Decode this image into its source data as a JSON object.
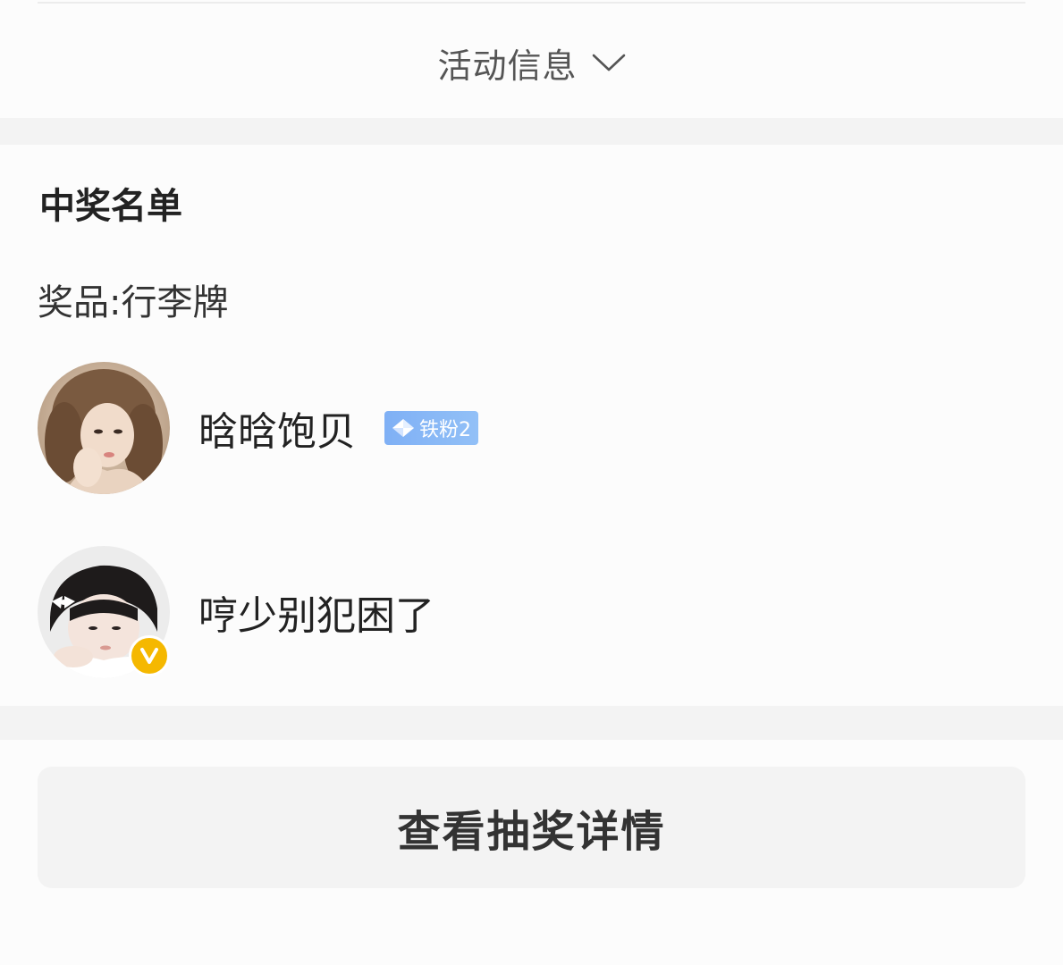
{
  "activity": {
    "label": "活动信息",
    "icon": "chevron-down-icon"
  },
  "winners": {
    "title": "中奖名单",
    "prize_line": "奖品:行李牌",
    "items": [
      {
        "name": "晗晗饱贝",
        "avatar_icon": "user-avatar",
        "badge": {
          "icon": "diamond-icon",
          "label": "铁粉2",
          "color": "#8bb8f6"
        }
      },
      {
        "name": "哼少别犯困了",
        "avatar_icon": "user-avatar",
        "verified": {
          "icon": "verified-v-icon",
          "color": "#f5b800"
        }
      }
    ]
  },
  "footer": {
    "detail_button_label": "查看抽奖详情"
  },
  "colors": {
    "background": "#fcfcfc",
    "separator": "#f3f3f3",
    "button_bg": "#f3f3f3",
    "text_primary": "#222222",
    "text_secondary": "#555555"
  }
}
